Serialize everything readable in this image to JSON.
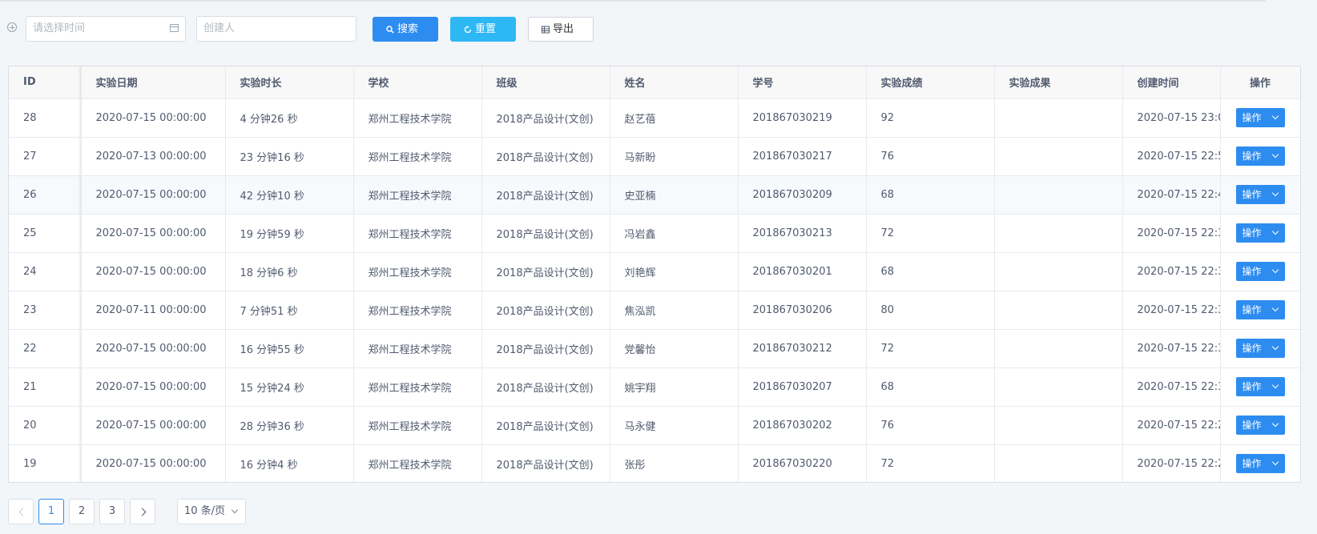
{
  "filters": {
    "date_placeholder": "请选择时间",
    "creator_placeholder": "创建人"
  },
  "toolbar": {
    "search_label": "搜索",
    "reset_label": "重置",
    "export_label": "导出"
  },
  "table": {
    "columns": [
      "ID",
      "实验日期",
      "实验时长",
      "学校",
      "班级",
      "姓名",
      "学号",
      "实验成绩",
      "实验成果",
      "创建时间",
      "操作"
    ],
    "action_label": "操作",
    "rows": [
      {
        "id": "28",
        "date": "2020-07-15 00:00:00",
        "duration": "4 分钟26 秒",
        "school": "郑州工程技术学院",
        "class": "2018产品设计(文创)",
        "name": "赵艺蓓",
        "student_no": "201867030219",
        "score": "92",
        "result": "",
        "created": "2020-07-15 23:0"
      },
      {
        "id": "27",
        "date": "2020-07-13 00:00:00",
        "duration": "23 分钟16 秒",
        "school": "郑州工程技术学院",
        "class": "2018产品设计(文创)",
        "name": "马新盼",
        "student_no": "201867030217",
        "score": "76",
        "result": "",
        "created": "2020-07-15 22:5"
      },
      {
        "id": "26",
        "date": "2020-07-15 00:00:00",
        "duration": "42 分钟10 秒",
        "school": "郑州工程技术学院",
        "class": "2018产品设计(文创)",
        "name": "史亚楠",
        "student_no": "201867030209",
        "score": "68",
        "result": "",
        "created": "2020-07-15 22:4"
      },
      {
        "id": "25",
        "date": "2020-07-15 00:00:00",
        "duration": "19 分钟59 秒",
        "school": "郑州工程技术学院",
        "class": "2018产品设计(文创)",
        "name": "冯岩鑫",
        "student_no": "201867030213",
        "score": "72",
        "result": "",
        "created": "2020-07-15 22:3"
      },
      {
        "id": "24",
        "date": "2020-07-15 00:00:00",
        "duration": "18 分钟6 秒",
        "school": "郑州工程技术学院",
        "class": "2018产品设计(文创)",
        "name": "刘艳辉",
        "student_no": "201867030201",
        "score": "68",
        "result": "",
        "created": "2020-07-15 22:3"
      },
      {
        "id": "23",
        "date": "2020-07-11 00:00:00",
        "duration": "7 分钟51 秒",
        "school": "郑州工程技术学院",
        "class": "2018产品设计(文创)",
        "name": "焦泓凯",
        "student_no": "201867030206",
        "score": "80",
        "result": "",
        "created": "2020-07-15 22:3"
      },
      {
        "id": "22",
        "date": "2020-07-15 00:00:00",
        "duration": "16 分钟55 秒",
        "school": "郑州工程技术学院",
        "class": "2018产品设计(文创)",
        "name": "党馨怡",
        "student_no": "201867030212",
        "score": "72",
        "result": "",
        "created": "2020-07-15 22:3"
      },
      {
        "id": "21",
        "date": "2020-07-15 00:00:00",
        "duration": "15 分钟24 秒",
        "school": "郑州工程技术学院",
        "class": "2018产品设计(文创)",
        "name": "姚宇翔",
        "student_no": "201867030207",
        "score": "68",
        "result": "",
        "created": "2020-07-15 22:3"
      },
      {
        "id": "20",
        "date": "2020-07-15 00:00:00",
        "duration": "28 分钟36 秒",
        "school": "郑州工程技术学院",
        "class": "2018产品设计(文创)",
        "name": "马永健",
        "student_no": "201867030202",
        "score": "76",
        "result": "",
        "created": "2020-07-15 22:2"
      },
      {
        "id": "19",
        "date": "2020-07-15 00:00:00",
        "duration": "16 分钟4 秒",
        "school": "郑州工程技术学院",
        "class": "2018产品设计(文创)",
        "name": "张彤",
        "student_no": "201867030220",
        "score": "72",
        "result": "",
        "created": "2020-07-15 22:2"
      }
    ]
  },
  "pagination": {
    "pages": [
      "1",
      "2",
      "3"
    ],
    "current": "1",
    "page_size_label": "10 条/页"
  },
  "icons": {
    "expand": "plus-circle-icon",
    "calendar": "calendar-icon",
    "search": "search-icon",
    "reset": "refresh-icon",
    "export": "table-icon",
    "dropdown": "chevron-down-icon"
  },
  "colors": {
    "primary": "#2d8cf0",
    "info": "#2db7f5",
    "row_highlight": "#f6fafd"
  }
}
